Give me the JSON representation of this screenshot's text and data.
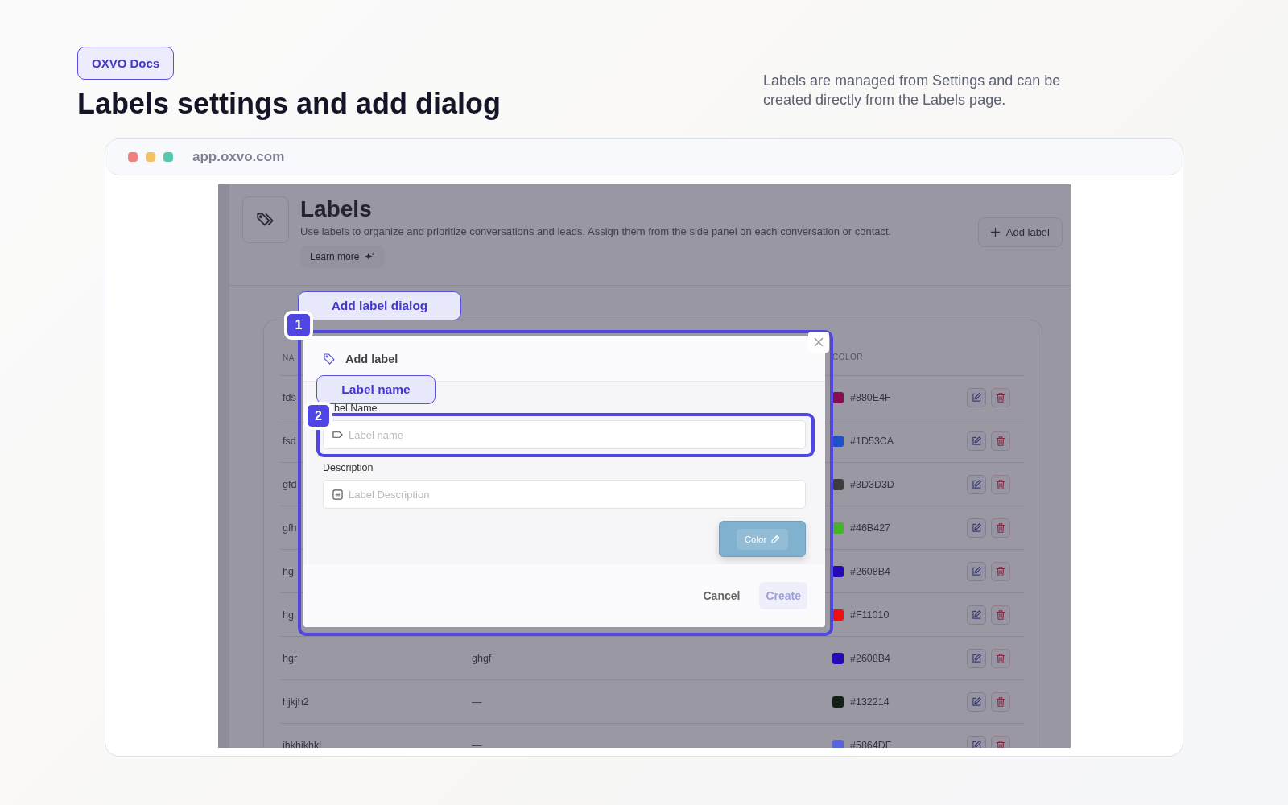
{
  "doc": {
    "badge": "OXVO Docs",
    "title": "Labels settings and add dialog",
    "summary": "Labels are managed from Settings and can be created directly from the Labels page."
  },
  "browser": {
    "url": "app.oxvo.com"
  },
  "app": {
    "title": "Labels",
    "description": "Use labels to organize and prioritize conversations and leads. Assign them from the side panel on each conversation or contact.",
    "learn_more": "Learn more",
    "add_button": "Add label"
  },
  "table": {
    "columns": [
      "NA",
      "COLOR"
    ],
    "rows": [
      {
        "name": "fds",
        "color": "#880E4F",
        "color_label": "#880E4F"
      },
      {
        "name": "fsd",
        "color": "#1D53CA",
        "color_label": "#1D53CA"
      },
      {
        "name": "gfd",
        "color": "#3D3D3D",
        "color_label": "#3D3D3D"
      },
      {
        "name": "gfh",
        "color": "#46B427",
        "color_label": "#46B427"
      },
      {
        "name": "hg",
        "color": "#2608B4",
        "color_label": "#2608B4"
      },
      {
        "name": "hg",
        "color": "#F11010",
        "color_label": "#F11010"
      },
      {
        "name": "hgr",
        "description": "ghgf",
        "color": "#2608B4",
        "color_label": "#2608B4"
      },
      {
        "name": "hjkjh2",
        "description": "—",
        "color": "#132214",
        "color_label": "#132214"
      },
      {
        "name": "ihkhikhkl",
        "description": "—",
        "color": "#5864DF",
        "color_label": "#5864DF"
      }
    ]
  },
  "dialog": {
    "title": "Add label",
    "fields": [
      {
        "label": "bel Name",
        "placeholder": "Label name",
        "kind": "tag"
      },
      {
        "label": "Description",
        "placeholder": "Label Description",
        "kind": "text"
      }
    ],
    "color_button": "Color",
    "cancel": "Cancel",
    "create": {
      "label": "Create",
      "disabled": true
    }
  },
  "callouts": [
    {
      "number": "1",
      "label": "Add label dialog"
    },
    {
      "number": "2",
      "label": "Label name"
    }
  ]
}
